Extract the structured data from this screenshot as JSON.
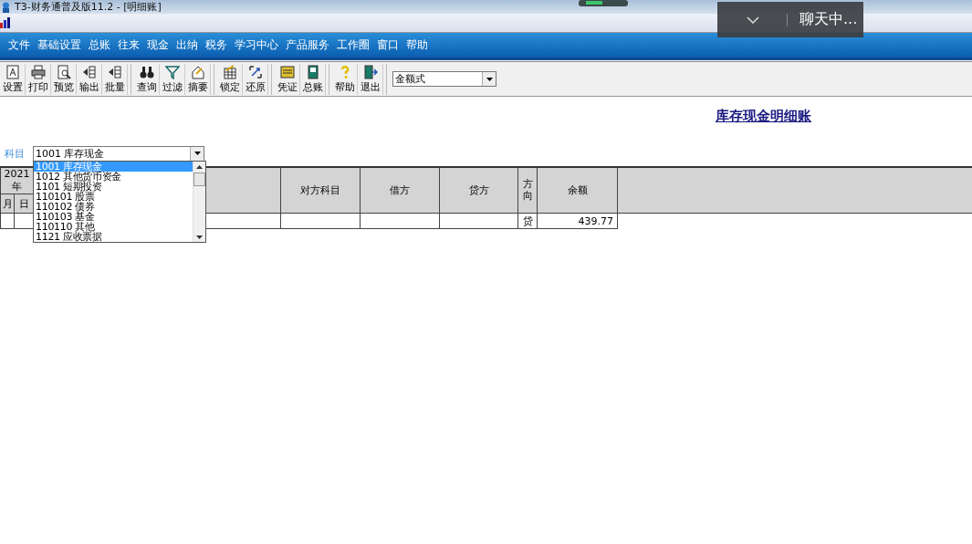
{
  "window": {
    "title": "T3-财务通普及版11.2 - [明细账]"
  },
  "chat_overlay": {
    "label": "聊天中..."
  },
  "menu": [
    "文件",
    "基础设置",
    "总账",
    "往来",
    "现金",
    "出纳",
    "税务",
    "学习中心",
    "产品服务",
    "工作圈",
    "窗口",
    "帮助"
  ],
  "toolbar": [
    [
      "设置",
      "打印",
      "预览",
      "输出",
      "批量"
    ],
    [
      "查询",
      "过滤",
      "摘要"
    ],
    [
      "锁定",
      "还原"
    ],
    [
      "凭证",
      "总账"
    ],
    [
      "帮助",
      "退出"
    ]
  ],
  "format_select": {
    "value": "金额式"
  },
  "report_title": "库存现金明细账",
  "account": {
    "label": "科目",
    "value": "1001  库存现金",
    "options": [
      {
        "text": "1001  库存现金",
        "selected": true
      },
      {
        "text": "1012  其他货币资金",
        "selected": false
      },
      {
        "text": "1101  短期投资",
        "selected": false
      },
      {
        "text": "110101  股票",
        "selected": false
      },
      {
        "text": "110102  债券",
        "selected": false
      },
      {
        "text": "110103  基金",
        "selected": false
      },
      {
        "text": "110110  其他",
        "selected": false
      },
      {
        "text": "1121  应收票据",
        "selected": false
      }
    ]
  },
  "table": {
    "year": "2021年",
    "month": "月",
    "day": "日",
    "columns": [
      "对方科目",
      "借方",
      "贷方",
      "方向",
      "余额"
    ],
    "rows": [
      {
        "direction": "贷",
        "balance": "439.77"
      }
    ]
  }
}
